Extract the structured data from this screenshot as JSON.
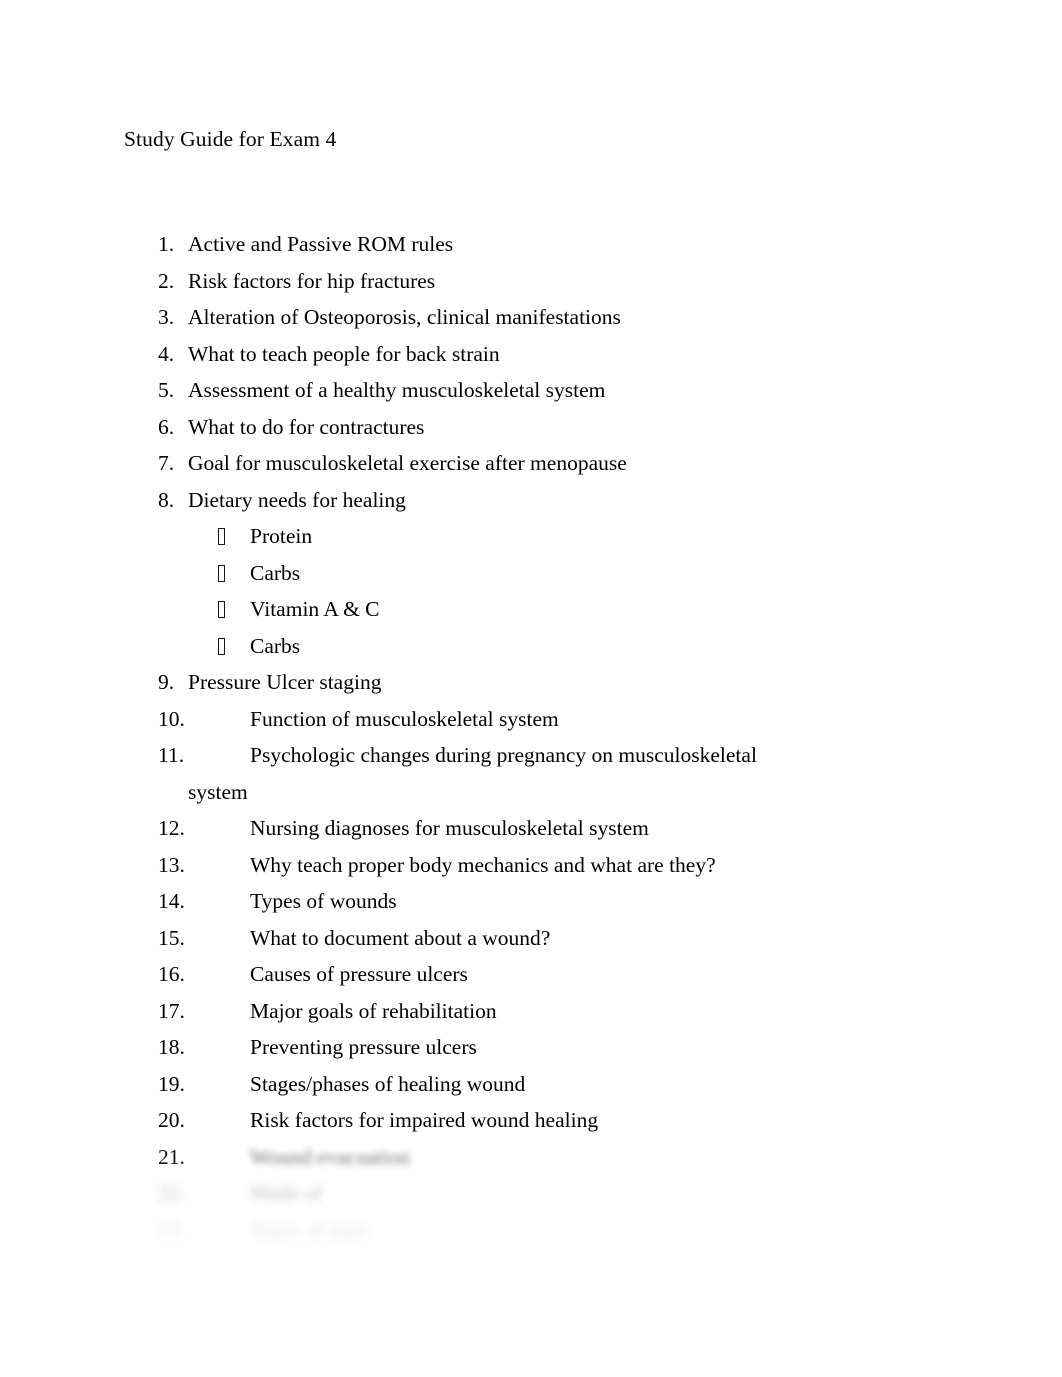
{
  "document": {
    "title": "Study Guide for Exam 4",
    "background_color": "#ffffff",
    "text_color": "#000000"
  },
  "list": {
    "items": [
      {
        "number": "1.",
        "text": "Active and Passive ROM rules"
      },
      {
        "number": "2.",
        "text": "Risk factors for hip fractures"
      },
      {
        "number": "3.",
        "text": "Alteration of Osteoporosis, clinical manifestations"
      },
      {
        "number": "4.",
        "text": "What to teach people for back strain"
      },
      {
        "number": "5.",
        "text": "Assessment of a healthy musculoskeletal system"
      },
      {
        "number": "6.",
        "text": "What to do for contractures"
      },
      {
        "number": "7.",
        "text": "Goal for musculoskeletal exercise after menopause"
      },
      {
        "number": "8.",
        "text": "Dietary needs for healing"
      }
    ],
    "sub_items": [
      {
        "bullet": "wingding-box-bullet",
        "text": "Protein"
      },
      {
        "bullet": "wingding-box-bullet",
        "text": "Carbs"
      },
      {
        "bullet": "wingding-box-bullet",
        "text": "Vitamin A & C"
      },
      {
        "bullet": "wingding-box-bullet",
        "text": "Carbs"
      }
    ],
    "items_after": [
      {
        "number": "9.",
        "text": "Pressure Ulcer staging"
      },
      {
        "number": "10.",
        "text": "Function of musculoskeletal system"
      },
      {
        "number": "11.",
        "text": "Psychologic changes during pregnancy on musculoskeletal"
      },
      {
        "number": "",
        "text": "system"
      },
      {
        "number": "12.",
        "text": "Nursing diagnoses for musculoskeletal system"
      },
      {
        "number": "13.",
        "text": "Why teach proper body mechanics and what are they?"
      },
      {
        "number": "14.",
        "text": "Types of wounds"
      },
      {
        "number": "15.",
        "text": "What to document about a wound?"
      },
      {
        "number": "16.",
        "text": "Causes of pressure ulcers"
      },
      {
        "number": "17.",
        "text": "Major goals of rehabilitation"
      },
      {
        "number": "18.",
        "text": "Preventing pressure ulcers"
      },
      {
        "number": "19.",
        "text": "Stages/phases of healing wound"
      },
      {
        "number": "20.",
        "text": "Risk factors for impaired wound healing"
      }
    ],
    "obscured_items": [
      {
        "number": "21.",
        "text": "Wound evacuation"
      },
      {
        "number": "22.",
        "text": "Made of"
      },
      {
        "number": "23.",
        "text": "Types of pain"
      }
    ]
  }
}
